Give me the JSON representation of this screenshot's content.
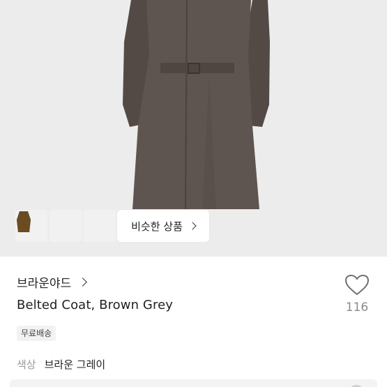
{
  "product_image": {
    "coat_color": "#5d534d",
    "background": "#ececec"
  },
  "thumbnails": [
    {
      "icon": "coat-grey-thumb",
      "color": "#4e4b4b"
    },
    {
      "icon": "coat-olive-thumb",
      "color": "#6a5a3e"
    },
    {
      "icon": "coat-brown-thumb",
      "color": "#6b4c21"
    }
  ],
  "similar": {
    "label": "비슷한 상품"
  },
  "brand": {
    "name": "브라운야드"
  },
  "product": {
    "title": "Belted Coat, Brown Grey"
  },
  "like": {
    "count": "116"
  },
  "shipping": {
    "badge": "무료배송"
  },
  "option": {
    "label": "색상",
    "value": "브라운 그레이"
  }
}
